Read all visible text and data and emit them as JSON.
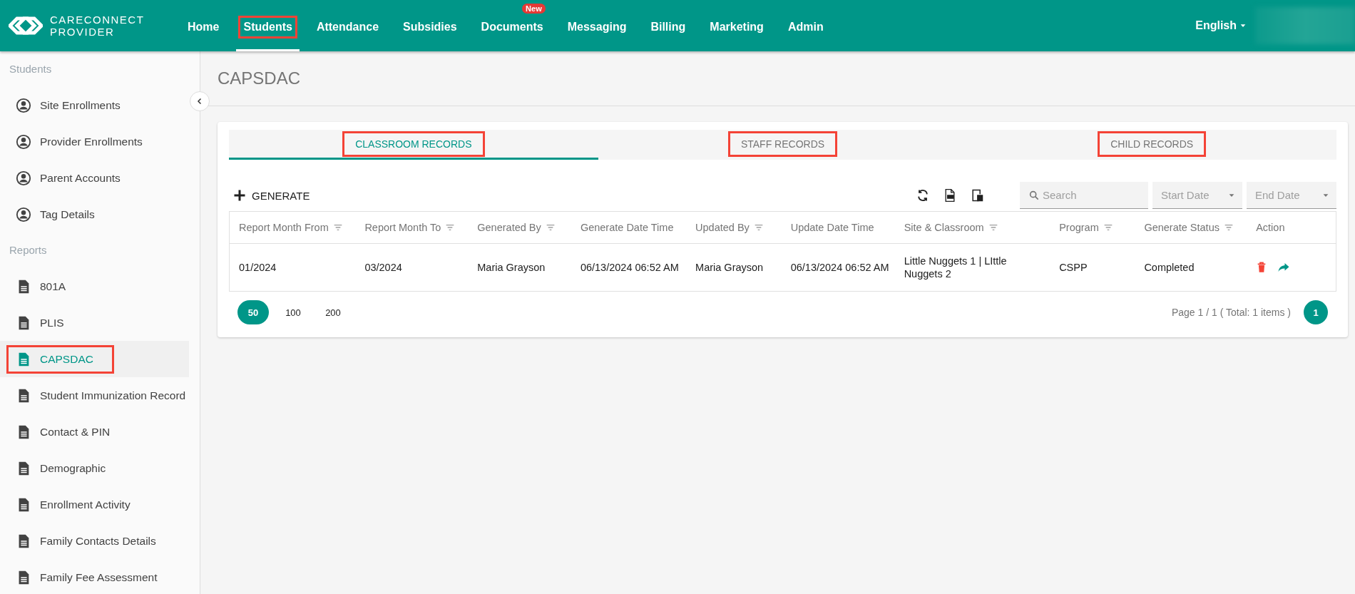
{
  "header": {
    "logo": {
      "line1": "CARECONNECT",
      "line2": "PROVIDER"
    },
    "nav": [
      {
        "label": "Home",
        "selected": false,
        "highlighted": false
      },
      {
        "label": "Students",
        "selected": true,
        "highlighted": true
      },
      {
        "label": "Attendance",
        "selected": false,
        "highlighted": false
      },
      {
        "label": "Subsidies",
        "selected": false,
        "highlighted": false
      },
      {
        "label": "Documents",
        "selected": false,
        "highlighted": false,
        "badge": "New"
      },
      {
        "label": "Messaging",
        "selected": false,
        "highlighted": false
      },
      {
        "label": "Billing",
        "selected": false,
        "highlighted": false
      },
      {
        "label": "Marketing",
        "selected": false,
        "highlighted": false
      },
      {
        "label": "Admin",
        "selected": false,
        "highlighted": false
      }
    ],
    "language": "English"
  },
  "sidebar": {
    "sections": [
      {
        "title": "Students",
        "items": [
          {
            "label": "Site Enrollments",
            "kind": "person",
            "selected": false,
            "highlighted": false
          },
          {
            "label": "Provider Enrollments",
            "kind": "person",
            "selected": false,
            "highlighted": false
          },
          {
            "label": "Parent Accounts",
            "kind": "person",
            "selected": false,
            "highlighted": false
          },
          {
            "label": "Tag Details",
            "kind": "person",
            "selected": false,
            "highlighted": false
          }
        ]
      },
      {
        "title": "Reports",
        "items": [
          {
            "label": "801A",
            "kind": "document",
            "selected": false,
            "highlighted": false
          },
          {
            "label": "PLIS",
            "kind": "document",
            "selected": false,
            "highlighted": false
          },
          {
            "label": "CAPSDAC",
            "kind": "document",
            "selected": true,
            "highlighted": true
          },
          {
            "label": "Student Immunization Record",
            "kind": "document",
            "selected": false,
            "highlighted": false
          },
          {
            "label": "Contact & PIN",
            "kind": "document",
            "selected": false,
            "highlighted": false
          },
          {
            "label": "Demographic",
            "kind": "document",
            "selected": false,
            "highlighted": false
          },
          {
            "label": "Enrollment Activity",
            "kind": "document",
            "selected": false,
            "highlighted": false
          },
          {
            "label": "Family Contacts Details",
            "kind": "document",
            "selected": false,
            "highlighted": false
          },
          {
            "label": "Family Fee Assessment",
            "kind": "document",
            "selected": false,
            "highlighted": false
          }
        ]
      }
    ]
  },
  "page": {
    "title": "CAPSDAC"
  },
  "tabs": [
    {
      "label": "CLASSROOM RECORDS",
      "selected": true,
      "highlighted": true
    },
    {
      "label": "STAFF RECORDS",
      "selected": false,
      "highlighted": true
    },
    {
      "label": "CHILD RECORDS",
      "selected": false,
      "highlighted": true
    }
  ],
  "toolbar": {
    "generate": "GENERATE",
    "search": {
      "placeholder": "Search"
    },
    "start_date": {
      "placeholder": "Start Date"
    },
    "end_date": {
      "placeholder": "End Date"
    }
  },
  "table": {
    "columns": [
      {
        "label": "Report Month From",
        "filter": true
      },
      {
        "label": "Report Month To",
        "filter": true
      },
      {
        "label": "Generated By",
        "filter": true
      },
      {
        "label": "Generate Date Time",
        "filter": false
      },
      {
        "label": "Updated By",
        "filter": true
      },
      {
        "label": "Update Date Time",
        "filter": false
      },
      {
        "label": "Site & Classroom",
        "filter": true
      },
      {
        "label": "Program",
        "filter": true
      },
      {
        "label": "Generate Status",
        "filter": true
      },
      {
        "label": "Action",
        "filter": false
      }
    ],
    "rows": [
      {
        "cells": [
          "01/2024",
          "03/2024",
          "Maria Grayson",
          "06/13/2024 06:52 AM",
          "Maria Grayson",
          "06/13/2024 06:52 AM",
          "Little Nuggets 1 | LIttle Nuggets 2",
          "CSPP",
          "Completed"
        ]
      }
    ]
  },
  "pagination": {
    "page_sizes": [
      {
        "label": "50",
        "selected": true
      },
      {
        "label": "100",
        "selected": false
      },
      {
        "label": "200",
        "selected": false
      }
    ],
    "summary": "Page 1 / 1 ( Total: 1 items )",
    "pages": [
      {
        "label": "1",
        "selected": true
      }
    ]
  }
}
